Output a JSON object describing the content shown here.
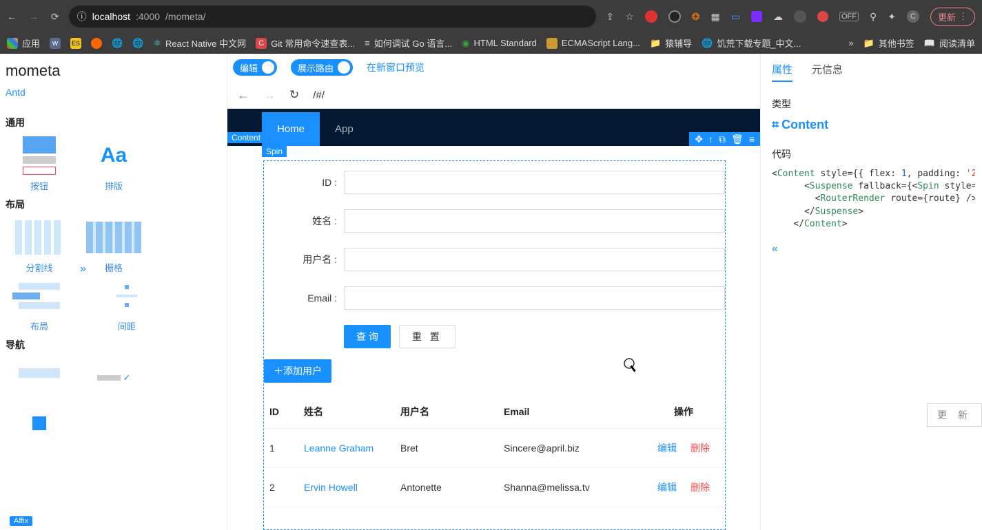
{
  "browser": {
    "host": "localhost",
    "port": ":4000",
    "path": "/mometa/",
    "update_btn": "更新",
    "profile_letter": "C"
  },
  "bookmarks": {
    "apps": "应用",
    "react_native": "React Native 中文网",
    "git": "Git 常用命令速查表...",
    "go": "如何调试 Go 语言...",
    "html": "HTML Standard",
    "ecma": "ECMAScript Lang...",
    "yuan": "猿辅导",
    "dl": "饥荒下载专题_中文...",
    "more": "»",
    "other": "其他书签",
    "readlist": "阅读清单"
  },
  "app": {
    "title": "mometa",
    "left_tab": "Antd",
    "sections": {
      "general": "通用",
      "layout": "布局",
      "nav": "导航"
    },
    "thumbs": {
      "button": "按钮",
      "typography": "排版",
      "divider": "分割线",
      "grid": "栅格",
      "layout": "布局",
      "space": "间距",
      "affix": "Affix"
    },
    "toolbar": {
      "edit": "编辑",
      "route": "展示路由",
      "new_window": "在新窗口预览"
    },
    "mini_nav": {
      "hash": "/#/"
    },
    "tags": {
      "content": "Content",
      "spin": "Spin"
    },
    "nav_tabs": {
      "home": "Home",
      "app": "App"
    },
    "form": {
      "id": "ID :",
      "name": "姓名 :",
      "username": "用户名 :",
      "email": "Email :",
      "query": "查 询",
      "reset": "重 置",
      "add_user": "＋添加用户"
    },
    "table": {
      "cols": {
        "id": "ID",
        "name": "姓名",
        "username": "用户名",
        "email": "Email",
        "actions": "操作"
      },
      "edit": "编辑",
      "delete": "删除",
      "rows": [
        {
          "id": "1",
          "name": "Leanne Graham",
          "username": "Bret",
          "email": "Sincere@april.biz"
        },
        {
          "id": "2",
          "name": "Ervin Howell",
          "username": "Antonette",
          "email": "Shanna@melissa.tv"
        }
      ]
    }
  },
  "right": {
    "tab_attr": "属性",
    "tab_meta": "元信息",
    "sec_type": "类型",
    "type_name": "Content",
    "sec_code": "代码",
    "update": "更 新"
  }
}
